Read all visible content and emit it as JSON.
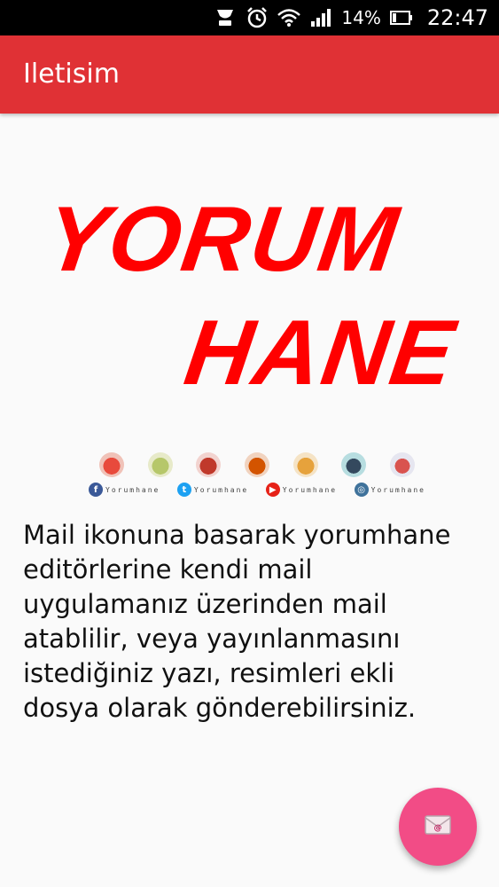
{
  "status_bar": {
    "battery_percent": "14%",
    "time": "22:47",
    "icons": [
      "notification-icon",
      "alarm-icon",
      "wifi-icon",
      "signal-icon",
      "battery-icon"
    ]
  },
  "app_bar": {
    "title": "Iletisim",
    "color": "#e03135"
  },
  "logo": {
    "line1": "YORUM",
    "line2": "HANE",
    "color": "#ff0000"
  },
  "badges": {
    "icons": [
      "laptop-icon",
      "cake-icon",
      "book-icon",
      "gift-icon",
      "calendar-icon",
      "phone-icon",
      "table-icon"
    ],
    "socials": [
      {
        "icon": "facebook-icon",
        "label": "Yorumhane",
        "color": "#3b5998",
        "glyph": "f"
      },
      {
        "icon": "twitter-icon",
        "label": "Yorumhane",
        "color": "#1da1f2",
        "glyph": "t"
      },
      {
        "icon": "youtube-icon",
        "label": "Yorumhane",
        "color": "#e62117",
        "glyph": "▶"
      },
      {
        "icon": "instagram-icon",
        "label": "Yorumhane",
        "color": "#3f729b",
        "glyph": "◎"
      }
    ]
  },
  "main": {
    "text_lines": [
      "Mail ikonuna basarak yorumhane",
      "editörlerine kendi mail",
      "uygulamanız üzerinden mail",
      "atablilir, veya yayınlanmasını",
      "istediğiniz yazı, resimleri ekli",
      "dosya olarak gönderebilirsiniz."
    ]
  },
  "fab": {
    "icon": "mail-icon",
    "color": "#f24c86"
  }
}
